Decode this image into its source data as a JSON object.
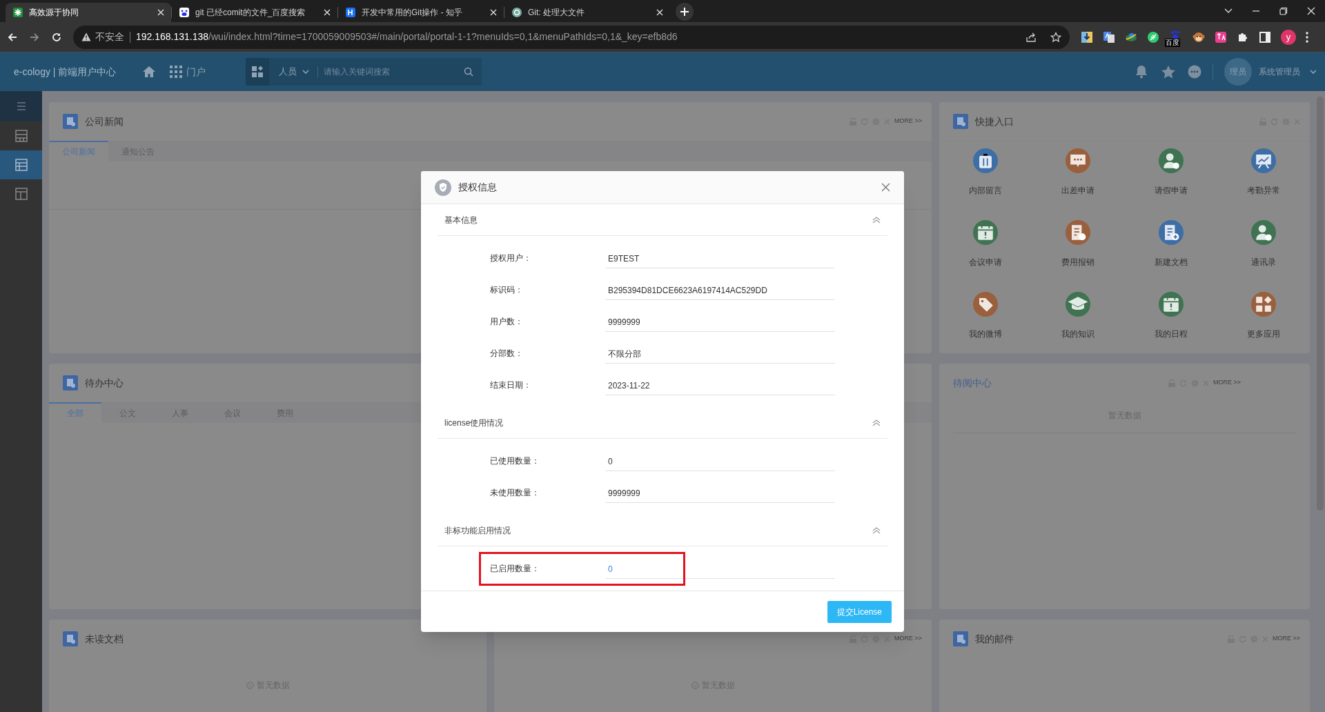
{
  "browser": {
    "tabs": [
      {
        "title": "高效源于协同",
        "selected": true
      },
      {
        "title": "git 已经comit的文件_百度搜索",
        "selected": false
      },
      {
        "title": "开发中常用的Git操作 - 知乎",
        "selected": false
      },
      {
        "title": "Git: 处理大文件",
        "selected": false
      }
    ],
    "url": {
      "security_label": "不安全",
      "host": "192.168.131.138",
      "path": "/wui/index.html?time=1700059009503#/main/portal/portal-1-1?menuIds=0,1&menuPathIds=0,1&_key=efb8d6"
    },
    "extension_badge": "百度",
    "profile_initial": "y"
  },
  "app_header": {
    "brand": "e-cology | 前端用户中心",
    "portal": "门户",
    "search": {
      "category": "人员",
      "placeholder": "请输入关键词搜索"
    },
    "user": {
      "avatar_text": "理员",
      "name": "系统管理员"
    }
  },
  "sidebar": {
    "items": [
      {
        "selected": false
      },
      {
        "selected": true
      },
      {
        "selected": false
      }
    ]
  },
  "news_card": {
    "title": "公司新闻",
    "tabs": [
      {
        "label": "公司新闻",
        "selected": true
      },
      {
        "label": "通知公告",
        "selected": false
      }
    ],
    "more": "MORE >>"
  },
  "quick_entry": {
    "title": "快捷入口",
    "items": [
      {
        "label": "内部留言",
        "color": "#3d6ea5"
      },
      {
        "label": "出差申请",
        "color": "#9a5f3c"
      },
      {
        "label": "请假申请",
        "color": "#3f7352"
      },
      {
        "label": "考勤异常",
        "color": "#3d6ea5"
      },
      {
        "label": "会议申请",
        "color": "#3f7352"
      },
      {
        "label": "费用报销",
        "color": "#9a5f3c"
      },
      {
        "label": "新建文档",
        "color": "#3d6ea5"
      },
      {
        "label": "通讯录",
        "color": "#3f7352"
      },
      {
        "label": "我的微博",
        "color": "#9a5f3c"
      },
      {
        "label": "我的知识",
        "color": "#3f7352"
      },
      {
        "label": "我的日程",
        "color": "#3f7352"
      },
      {
        "label": "更多应用",
        "color": "#9a5f3c"
      }
    ]
  },
  "todo_card": {
    "title": "待办中心",
    "tabs": [
      {
        "label": "全部",
        "selected": true
      },
      {
        "label": "公文",
        "selected": false
      },
      {
        "label": "人事",
        "selected": false
      },
      {
        "label": "会议",
        "selected": false
      },
      {
        "label": "费用",
        "selected": false
      }
    ]
  },
  "toread_card": {
    "title": "待阅中心",
    "more": "MORE >>",
    "empty": "暂无数据"
  },
  "unread_card": {
    "title": "未读文档",
    "empty": "暂无数据"
  },
  "download_card": {
    "more": "MORE >>",
    "empty": "暂无数据"
  },
  "mail_card": {
    "title": "我的邮件",
    "more": "MORE >>"
  },
  "dialog": {
    "title": "授权信息",
    "sections": [
      {
        "title": "基本信息",
        "expanded": true,
        "fields": [
          {
            "label": "授权用户：",
            "value": "E9TEST",
            "highlighted": false
          },
          {
            "label": "标识码：",
            "value": "B295394D81DCE6623A6197414AC529DD",
            "highlighted": false
          },
          {
            "label": "用户数：",
            "value": "9999999",
            "highlighted": false
          },
          {
            "label": "分部数：",
            "value": "不限分部",
            "highlighted": false
          },
          {
            "label": "结束日期：",
            "value": "2023-11-22",
            "highlighted": false
          }
        ]
      },
      {
        "title": "license使用情况",
        "expanded": true,
        "fields": [
          {
            "label": "已使用数量：",
            "value": "0",
            "highlighted": false
          },
          {
            "label": "未使用数量：",
            "value": "9999999",
            "highlighted": false
          }
        ]
      },
      {
        "title": "非标功能启用情况",
        "expanded": true,
        "fields": [
          {
            "label": "已启用数量：",
            "value": "0",
            "highlighted": true
          }
        ]
      }
    ],
    "submit_button": "提交License"
  }
}
